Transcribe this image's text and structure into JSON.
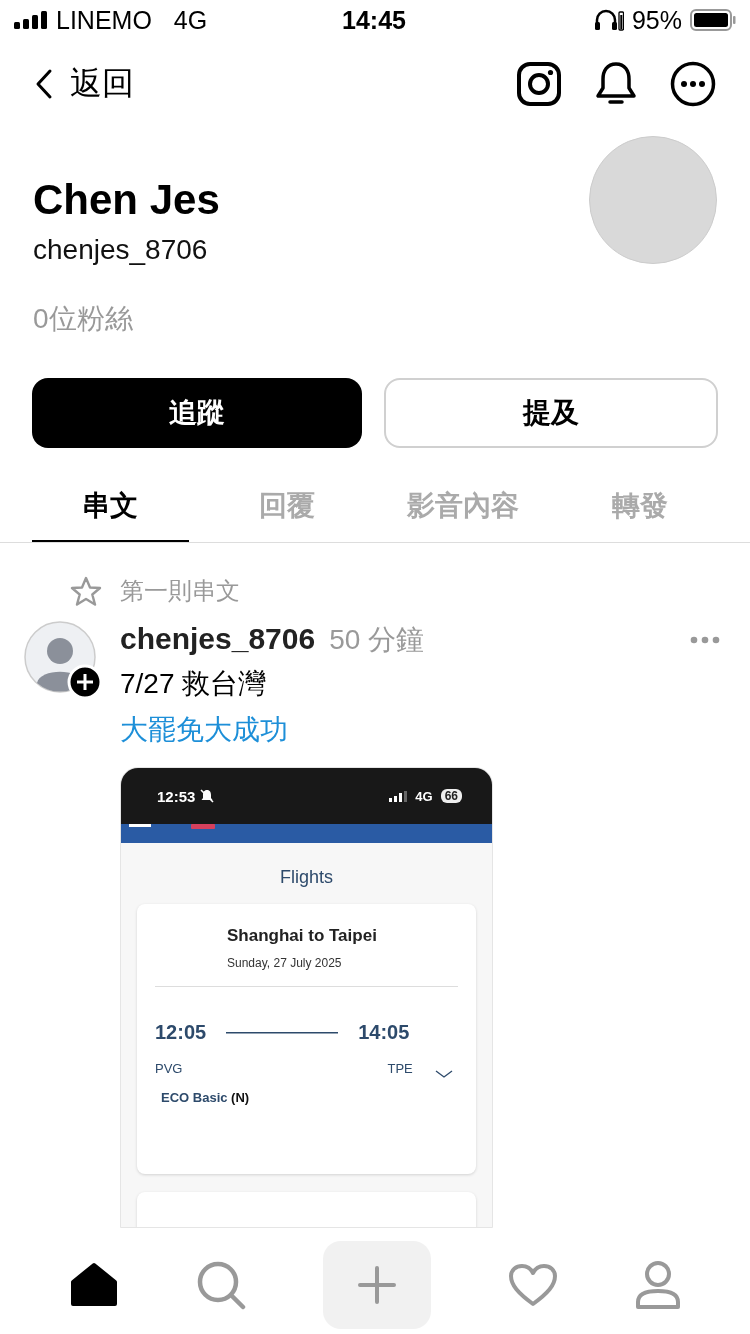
{
  "status_bar": {
    "carrier": "LINEMO",
    "network": "4G",
    "time": "14:45",
    "battery": "95%"
  },
  "nav": {
    "back": "返回"
  },
  "profile": {
    "name": "Chen Jes",
    "handle": "chenjes_8706",
    "followers": "0位粉絲"
  },
  "buttons": [
    {
      "label": "追蹤",
      "kind": "primary"
    },
    {
      "label": "提及",
      "kind": "secondary"
    }
  ],
  "tabs": [
    {
      "label": "串文",
      "selected": true
    },
    {
      "label": "回覆",
      "selected": false
    },
    {
      "label": "影音內容",
      "selected": false
    },
    {
      "label": "轉發",
      "selected": false
    }
  ],
  "pinned_label": "第一則串文",
  "post": {
    "author": "chenjes_8706",
    "time": "50 分鐘",
    "text": "7/27 救台灣",
    "link": "大罷免大成功",
    "screenshot": {
      "time": "12:53",
      "network": "4G",
      "battery": "66",
      "heading": "Flights",
      "card": {
        "route": "Shanghai to Taipei",
        "date": "Sunday, 27 July 2025",
        "depart_time": "12:05",
        "arrive_time": "14:05",
        "depart_code": "PVG",
        "arrive_code": "TPE",
        "fare": "ECO Basic",
        "fare_class": "(N)"
      }
    }
  },
  "bottom_nav": [
    {
      "kind": "home",
      "selected": true
    },
    {
      "kind": "search",
      "selected": false
    },
    {
      "kind": "compose",
      "selected": false
    },
    {
      "kind": "activity",
      "selected": false
    },
    {
      "kind": "profile",
      "selected": false
    }
  ]
}
